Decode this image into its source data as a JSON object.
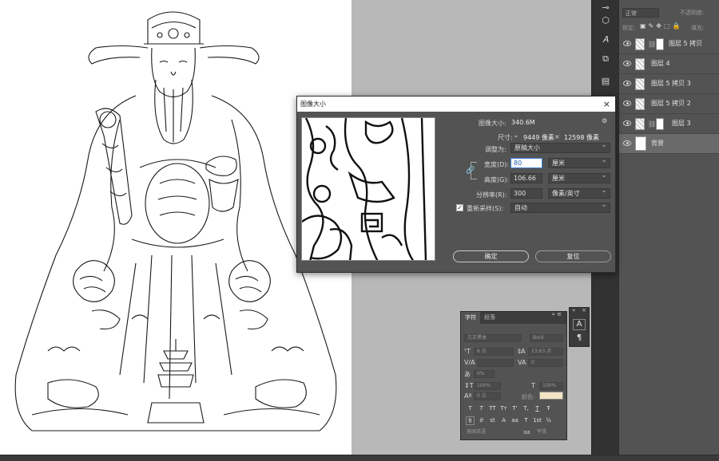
{
  "dialog": {
    "title": "图像大小",
    "image_size_label": "图像大小:",
    "image_size_value": "340.6M",
    "dimensions_label": "尺寸:",
    "dimensions_width": "9449 像素",
    "dimensions_times": "×",
    "dimensions_height": "12598 像素",
    "fit_to_label": "调整为:",
    "fit_to_value": "原稿大小",
    "width_label": "宽度(D):",
    "width_value": "80",
    "width_unit": "厘米",
    "height_label": "高度(G):",
    "height_value": "106.66",
    "height_unit": "厘米",
    "resolution_label": "分辨率(R):",
    "resolution_value": "300",
    "resolution_unit": "像素/英寸",
    "resample_label": "重新采样(S):",
    "resample_value": "自动",
    "ok_label": "确定",
    "cancel_label": "复位",
    "close_glyph": "×",
    "gear_glyph": "⚙"
  },
  "layers_panel": {
    "blend_mode": "正常",
    "opacity_label": "不透明度:",
    "lock_label": "锁定:",
    "fill_label": "填充:",
    "layers": [
      {
        "name": "图层 5 拷贝"
      },
      {
        "name": "图层 4"
      },
      {
        "name": "图层 5 拷贝 3"
      },
      {
        "name": "图层 5 拷贝 2"
      },
      {
        "name": "图层 3"
      },
      {
        "name": "背景"
      }
    ]
  },
  "character_panel": {
    "tab_character": "字符",
    "tab_paragraph": "段落",
    "font_family": "方正黑体",
    "font_style": "Bold",
    "font_size": "6 点",
    "leading": "13.63 点",
    "kerning": "度量标准",
    "tracking": "0",
    "scale_pct": "0%",
    "vscale": "100%",
    "hscale": "100%",
    "baseline": "0 点",
    "color_label": "颜色:",
    "language": "美国英语",
    "aa_label": "aa",
    "aa_value": "平滑",
    "style_buttons": [
      "T",
      "T",
      "TT",
      "Tт",
      "T'",
      "T,",
      "T",
      "Ŧ"
    ],
    "ot_buttons": [
      "fi",
      "ớ",
      "st",
      "A",
      "aa",
      "T",
      "1st",
      "½"
    ]
  },
  "colors": {
    "char_color_swatch": "#f2e4c4",
    "dialog_bg": "#535353",
    "pasteboard": "#b8b8b8"
  }
}
